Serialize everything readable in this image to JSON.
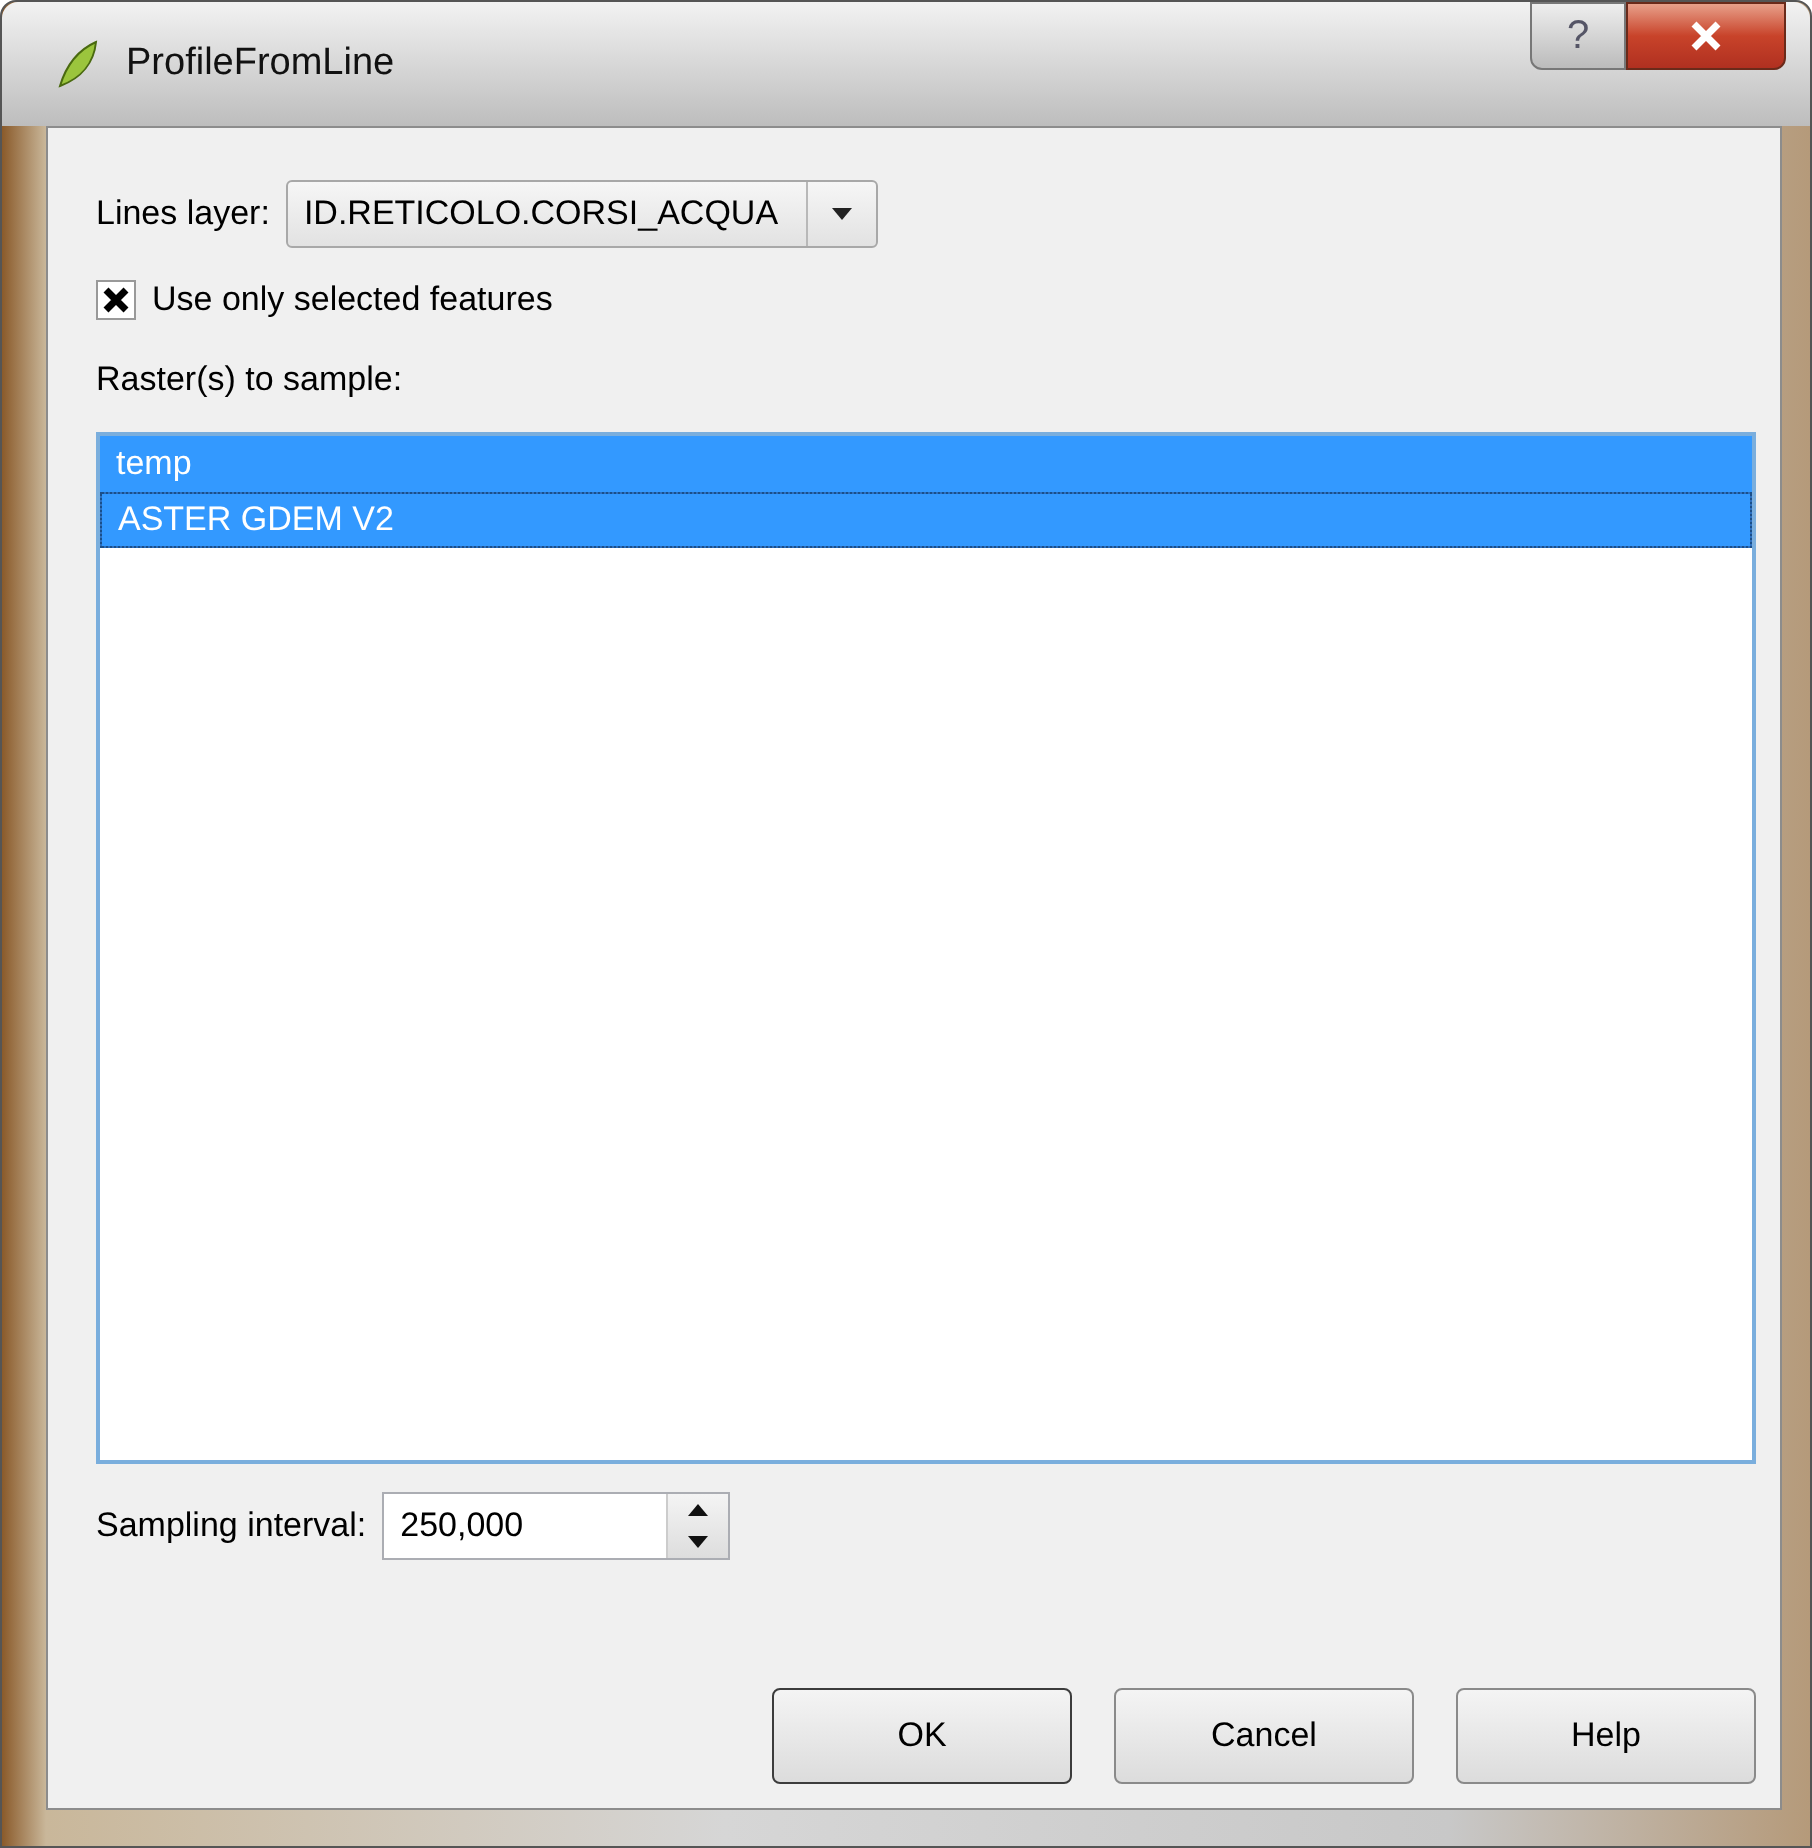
{
  "window": {
    "title": "ProfileFromLine",
    "help_button": "?"
  },
  "lines_layer": {
    "label": "Lines layer:",
    "value": "ID.RETICOLO.CORSI_ACQUA"
  },
  "use_selected": {
    "label": "Use only selected features",
    "checked": true
  },
  "rasters": {
    "label": "Raster(s) to sample:",
    "items": [
      {
        "name": "temp",
        "selected": true,
        "focused": false
      },
      {
        "name": "ASTER GDEM V2",
        "selected": true,
        "focused": true
      }
    ]
  },
  "sampling_interval": {
    "label": "Sampling interval:",
    "value": "250,000"
  },
  "buttons": [
    "OK",
    "Cancel",
    "Help"
  ]
}
